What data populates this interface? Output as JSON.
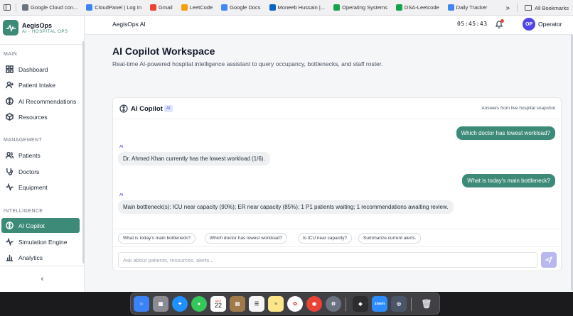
{
  "bookmarks": [
    {
      "label": "Google Cloud con...",
      "icon": "globe-icon",
      "color": "#6b7280"
    },
    {
      "label": "CloudPanel | Log In",
      "icon": "cloudpanel-icon",
      "color": "#3b82f6"
    },
    {
      "label": "Gmail",
      "icon": "gmail-icon",
      "color": "#ea4335"
    },
    {
      "label": "LeetCode",
      "icon": "leetcode-icon",
      "color": "#f59e0b"
    },
    {
      "label": "Google Docs",
      "icon": "docs-icon",
      "color": "#4285f4"
    },
    {
      "label": "Moneeb Hussain |...",
      "icon": "linkedin-icon",
      "color": "#0a66c2"
    },
    {
      "label": "Operating Systems",
      "icon": "youtube-icon",
      "color": "#16a34a"
    },
    {
      "label": "DSA-Leetcode",
      "icon": "youtube-icon",
      "color": "#16a34a"
    },
    {
      "label": "Daily Tracker",
      "icon": "docs-icon",
      "color": "#4285f4"
    }
  ],
  "bookmarks_more": "»",
  "all_bookmarks": "All Bookmarks",
  "brand": {
    "name": "AegisOps",
    "subtitle": "AI · HOSPITAL OPS"
  },
  "sidebar": {
    "sections": [
      {
        "label": "MAIN",
        "items": [
          {
            "label": "Dashboard",
            "icon": "dashboard-icon"
          },
          {
            "label": "Patient Intake",
            "icon": "patient-intake-icon"
          },
          {
            "label": "AI Recommendations",
            "icon": "ai-recommendations-icon"
          },
          {
            "label": "Resources",
            "icon": "resources-icon"
          }
        ]
      },
      {
        "label": "MANAGEMENT",
        "items": [
          {
            "label": "Patients",
            "icon": "patients-icon"
          },
          {
            "label": "Doctors",
            "icon": "stethoscope-icon"
          },
          {
            "label": "Equipment",
            "icon": "pulse-icon"
          }
        ]
      },
      {
        "label": "INTELLIGENCE",
        "items": [
          {
            "label": "AI Copilot",
            "icon": "copilot-icon",
            "active": true
          },
          {
            "label": "Simulation Engine",
            "icon": "simulation-icon"
          },
          {
            "label": "Analytics",
            "icon": "analytics-icon"
          }
        ]
      }
    ],
    "collapse_label": "‹"
  },
  "topbar": {
    "title": "AegisOps AI",
    "clock": "05:45:43",
    "avatar_initials": "OP",
    "user": "Operator"
  },
  "page": {
    "title": "AI Copilot Workspace",
    "subtitle": "Real-time AI-powered hospital intelligence assistant to query occupancy, bottlenecks, and staff roster."
  },
  "copilot": {
    "title": "AI Copilot",
    "badge": "AI",
    "note": "Answers from live hospital snapshot",
    "ai_tag": "AI",
    "messages": [
      {
        "role": "user",
        "text": "Which doctor has lowest workload?"
      },
      {
        "role": "ai",
        "text": "Dr. Ahmed Khan currently has the lowest workload (1/6)."
      },
      {
        "role": "user",
        "text": "What is today's main bottleneck?"
      },
      {
        "role": "ai",
        "text": "Main bottleneck(s): ICU near capacity (90%); ER near capacity (85%); 1 P1 patients waiting; 1 recommendations awaiting review."
      }
    ],
    "suggestions": [
      "What is today's main bottleneck?",
      "Which doctor has lowest workload?",
      "Is ICU near capacity?",
      "Summarize current alerts."
    ],
    "input_placeholder": "Ask about patients, resources, alerts..."
  },
  "colors": {
    "accent": "#3e8a78",
    "indigo": "#4f46e5",
    "alert": "#e5483f"
  },
  "dock": {
    "calendar_month": "OCT",
    "calendar_day": "22",
    "zoom_label": "zoom"
  }
}
